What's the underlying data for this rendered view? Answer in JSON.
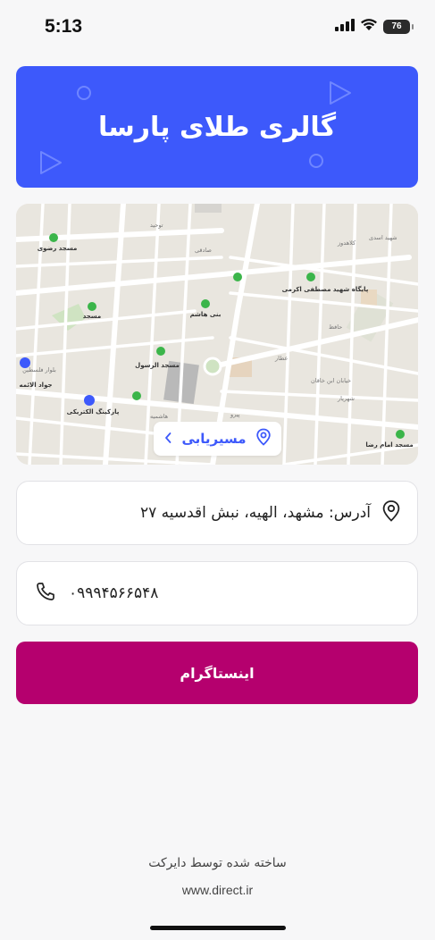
{
  "status_bar": {
    "time": "5:13",
    "battery": "76",
    "icons": [
      "signal-icon",
      "wifi-icon",
      "battery-icon"
    ]
  },
  "header": {
    "title": "گالری طلای پارسا",
    "background_color": "#3d59fb"
  },
  "map": {
    "route_button_label": "مسیریابی",
    "labels": [
      "مسجد رضوی",
      "مسجد",
      "بنی هاشم",
      "پایگاه شهید مصطفی اکرمی",
      "مسجد الرسول",
      "جواد الائمه",
      "بلوار فلسطین",
      "پارکینگ الکتریکی",
      "مسجد امام رضا"
    ],
    "streets": [
      "توحید",
      "صادقی",
      "کلاهدوز",
      "شهید اسدی",
      "حافظ",
      "عطار",
      "خیابان ابن خاقان",
      "شهریار",
      "پیرو",
      "هاشمیه"
    ]
  },
  "contact": {
    "address": "آدرس: مشهد، الهیه، نبش اقدسیه ۲۷",
    "phone": "۰۹۹۹۴۵۶۶۵۴۸"
  },
  "instagram": {
    "label": "اینستاگرام",
    "color": "#b5006e"
  },
  "footer": {
    "made_by": "ساخته شده توسط دایرکت",
    "url": "www.direct.ir"
  }
}
